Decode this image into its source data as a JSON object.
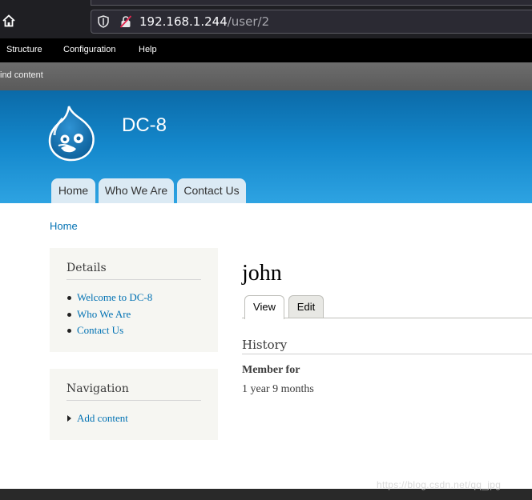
{
  "browser": {
    "url_host": "192.168.1.244",
    "url_path": "/user/2"
  },
  "admin_toolbar": {
    "items": [
      "Structure",
      "Configuration",
      "Help"
    ],
    "secondary": "ind content"
  },
  "site": {
    "name": "DC-8",
    "main_menu": [
      "Home",
      "Who We Are",
      "Contact Us"
    ]
  },
  "breadcrumb": "Home",
  "sidebar": {
    "details": {
      "title": "Details",
      "items": [
        "Welcome to DC-8",
        "Who We Are",
        "Contact Us"
      ]
    },
    "navigation": {
      "title": "Navigation",
      "items": [
        "Add content"
      ]
    }
  },
  "user_page": {
    "title": "john",
    "tabs": [
      "View",
      "Edit"
    ],
    "section_title": "History",
    "member_for_label": "Member for",
    "member_for_value": "1 year 9 months"
  },
  "watermark": "https://blog.csdn.net/qq_jpg",
  "colors": {
    "header_blue": "#1488cc",
    "link_blue": "#0071b3",
    "sidebar_bg": "#f6f6f2",
    "tab_bg": "#dbeaf4"
  }
}
